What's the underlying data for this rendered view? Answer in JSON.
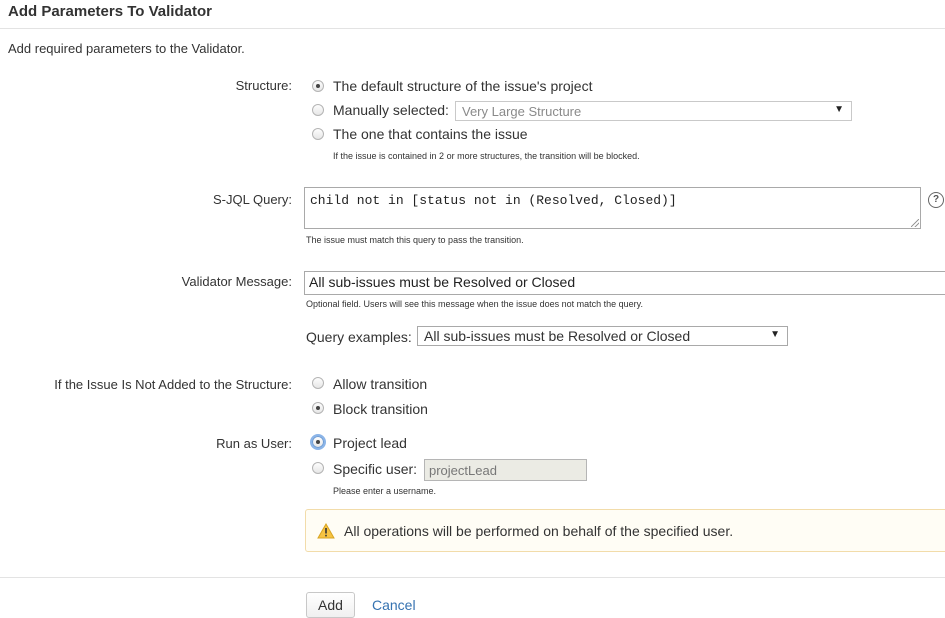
{
  "header": {
    "title": "Add Parameters To Validator",
    "description": "Add required parameters to the Validator."
  },
  "structure": {
    "label": "Structure:",
    "options": [
      {
        "label": "The default structure of the issue's project",
        "checked": true
      },
      {
        "label": "Manually selected:",
        "checked": false
      },
      {
        "label": "The one that contains the issue",
        "checked": false
      }
    ],
    "select_value": "Very Large Structure",
    "hint": "If the issue is contained in 2 or more structures, the transition will be blocked."
  },
  "sjql": {
    "label": "S-JQL Query:",
    "value": "child not in [status not in (Resolved, Closed)]",
    "hint": "The issue must match this query to pass the transition.",
    "help_icon": "question-circle-icon"
  },
  "validator_message": {
    "label": "Validator Message:",
    "value": "All sub-issues must be Resolved or Closed",
    "hint": "Optional field. Users will see this message when the issue does not match the query.",
    "examples_label": "Query examples:",
    "examples_value": "All sub-issues must be Resolved or Closed"
  },
  "not_added": {
    "label": "If the Issue Is Not Added to the Structure:",
    "options": [
      {
        "label": "Allow transition",
        "checked": false
      },
      {
        "label": "Block transition",
        "checked": true
      }
    ]
  },
  "run_as": {
    "label": "Run as User:",
    "options": [
      {
        "label": "Project lead",
        "checked": true
      },
      {
        "label": "Specific user:",
        "checked": false
      }
    ],
    "user_value": "projectLead",
    "hint": "Please enter a username.",
    "warning": "All operations will be performed on behalf of the specified user.",
    "warning_icon": "warning-triangle-icon"
  },
  "actions": {
    "add_label": "Add",
    "cancel_label": "Cancel"
  },
  "dropdown_arrow": "▼",
  "colors": {
    "link": "#3572b0",
    "warning_border": "#f2dcaa",
    "warning_icon": "#f6c342"
  }
}
